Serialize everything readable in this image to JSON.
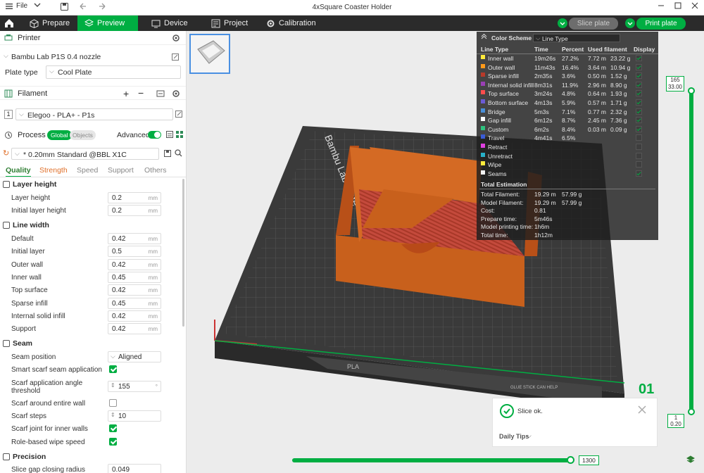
{
  "titlebar": {
    "file_label": "File",
    "window_title": "4xSquare Coaster Holder"
  },
  "tabs": [
    {
      "label": "Prepare"
    },
    {
      "label": "Preview"
    },
    {
      "label": "Device"
    },
    {
      "label": "Project"
    },
    {
      "label": "Calibration"
    }
  ],
  "actions": {
    "slice_label": "Slice plate",
    "print_label": "Print plate"
  },
  "printer": {
    "header": "Printer",
    "name": "Bambu Lab P1S 0.4 nozzle",
    "plate_label": "Plate type",
    "plate_value": "Cool Plate"
  },
  "filament": {
    "header": "Filament",
    "index": "1",
    "name": "Elegoo - PLA+ - P1s"
  },
  "process": {
    "header": "Process",
    "global": "Global",
    "objects": "Objects",
    "advanced": "Advanced",
    "profile": "* 0.20mm Standard @BBL X1C"
  },
  "subtabs": [
    "Quality",
    "Strength",
    "Speed",
    "Support",
    "Others"
  ],
  "settings": {
    "layer_height_group": "Layer height",
    "layer_height": {
      "label": "Layer height",
      "value": "0.2",
      "unit": "mm"
    },
    "initial_layer_height": {
      "label": "Initial layer height",
      "value": "0.2",
      "unit": "mm"
    },
    "line_width_group": "Line width",
    "line_widths": [
      {
        "label": "Default",
        "value": "0.42",
        "unit": "mm"
      },
      {
        "label": "Initial layer",
        "value": "0.5",
        "unit": "mm"
      },
      {
        "label": "Outer wall",
        "value": "0.42",
        "unit": "mm"
      },
      {
        "label": "Inner wall",
        "value": "0.45",
        "unit": "mm"
      },
      {
        "label": "Top surface",
        "value": "0.42",
        "unit": "mm"
      },
      {
        "label": "Sparse infill",
        "value": "0.45",
        "unit": "mm"
      },
      {
        "label": "Internal solid infill",
        "value": "0.42",
        "unit": "mm"
      },
      {
        "label": "Support",
        "value": "0.42",
        "unit": "mm"
      }
    ],
    "seam_group": "Seam",
    "seam_position": {
      "label": "Seam position",
      "value": "Aligned"
    },
    "smart_scarf": {
      "label": "Smart scarf seam application",
      "checked": true
    },
    "scarf_angle": {
      "label": "Scarf application angle threshold",
      "value": "155",
      "unit": "°"
    },
    "scarf_entire": {
      "label": "Scarf around entire wall",
      "checked": false
    },
    "scarf_steps": {
      "label": "Scarf steps",
      "value": "10"
    },
    "scarf_inner": {
      "label": "Scarf joint for inner walls",
      "checked": true
    },
    "role_wipe": {
      "label": "Role-based wipe speed",
      "checked": true
    },
    "precision_group": "Precision",
    "slice_gap": {
      "label": "Slice gap closing radius",
      "value": "0.049"
    }
  },
  "color_scheme": {
    "label": "Color Scheme",
    "mode": "Line Type",
    "headers": [
      "Line Type",
      "Time",
      "Percent",
      "Used filament",
      "Display"
    ],
    "rows": [
      {
        "name": "Inner wall",
        "color": "#ffeb3b",
        "time": "19m26s",
        "percent": "27.2%",
        "length": "7.72 m",
        "weight": "23.22 g",
        "display": true
      },
      {
        "name": "Outer wall",
        "color": "#ff9a1a",
        "time": "11m43s",
        "percent": "16.4%",
        "length": "3.64 m",
        "weight": "10.94 g",
        "display": true
      },
      {
        "name": "Sparse infill",
        "color": "#b83a2a",
        "time": "2m35s",
        "percent": "3.6%",
        "length": "0.50 m",
        "weight": "1.52 g",
        "display": true
      },
      {
        "name": "Internal solid infill",
        "color": "#9b3fb5",
        "time": "8m31s",
        "percent": "11.9%",
        "length": "2.96 m",
        "weight": "8.90 g",
        "display": true
      },
      {
        "name": "Top surface",
        "color": "#ff4d4d",
        "time": "3m24s",
        "percent": "4.8%",
        "length": "0.64 m",
        "weight": "1.93 g",
        "display": true
      },
      {
        "name": "Bottom surface",
        "color": "#6b5bd6",
        "time": "4m13s",
        "percent": "5.9%",
        "length": "0.57 m",
        "weight": "1.71 g",
        "display": true
      },
      {
        "name": "Bridge",
        "color": "#4a8fd8",
        "time": "5m3s",
        "percent": "7.1%",
        "length": "0.77 m",
        "weight": "2.32 g",
        "display": true
      },
      {
        "name": "Gap infill",
        "color": "#ffffff",
        "time": "6m12s",
        "percent": "8.7%",
        "length": "2.45 m",
        "weight": "7.36 g",
        "display": true
      },
      {
        "name": "Custom",
        "color": "#2ec27e",
        "time": "6m2s",
        "percent": "8.4%",
        "length": "0.03 m",
        "weight": "0.09 g",
        "display": true
      },
      {
        "name": "Travel",
        "color": "#3a5cd6",
        "time": "4m41s",
        "percent": "6.5%",
        "length": "",
        "weight": "",
        "display": false
      },
      {
        "name": "Retract",
        "color": "#e040e0",
        "time": "",
        "percent": "",
        "length": "",
        "weight": "",
        "display": false
      },
      {
        "name": "Unretract",
        "color": "#27b0c8",
        "time": "",
        "percent": "",
        "length": "",
        "weight": "",
        "display": false
      },
      {
        "name": "Wipe",
        "color": "#ffeb3b",
        "time": "",
        "percent": "",
        "length": "",
        "weight": "",
        "display": false
      },
      {
        "name": "Seams",
        "color": "#f2f2f2",
        "time": "",
        "percent": "",
        "length": "",
        "weight": "",
        "display": true
      }
    ]
  },
  "estimation": {
    "title": "Total Estimation",
    "rows": [
      {
        "label": "Total Filament:",
        "v1": "19.29 m",
        "v2": "57.99 g"
      },
      {
        "label": "Model Filament:",
        "v1": "19.29 m",
        "v2": "57.99 g"
      },
      {
        "label": "Cost:",
        "v1": "0.81",
        "v2": ""
      },
      {
        "label": "Prepare time:",
        "v1": "5m46s",
        "v2": ""
      },
      {
        "label": "Model printing time:",
        "v1": "1h6m",
        "v2": ""
      },
      {
        "label": "Total time:",
        "v1": "1h12m",
        "v2": ""
      }
    ]
  },
  "plate": {
    "brand": "Bambu Lab Plate",
    "plate_number": "01",
    "tag": "PLA",
    "glue_text": "GLUE STICK CAN HELP"
  },
  "toast": {
    "message": "Slice ok.",
    "tips": "Daily Tips"
  },
  "layers": {
    "top_layer": "165",
    "top_height": "33.00",
    "bottom_layer": "1",
    "bottom_height": "0.20",
    "horizontal_value": "1300",
    "horizontal_progress": 0.99
  }
}
